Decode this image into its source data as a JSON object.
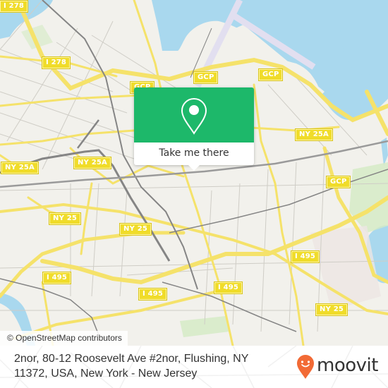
{
  "map": {
    "colors": {
      "land": "#f2f1ec",
      "water": "#a9d8ee",
      "park": "#d3ebc4",
      "airport": "#e2dff0",
      "road_major": "#f5e26a",
      "road_major_casing": "#e0c94a",
      "road_minor": "#cfcdc6",
      "rail": "#858585"
    },
    "shields": [
      {
        "label": "I 278",
        "id": "i278-top"
      },
      {
        "label": "I 278",
        "id": "i278"
      },
      {
        "label": "GCP",
        "id": "gcp-1"
      },
      {
        "label": "GCP",
        "id": "gcp-2"
      },
      {
        "label": "GCP",
        "id": "gcp-3"
      },
      {
        "label": "NY 25A",
        "id": "ny25a-1"
      },
      {
        "label": "NY 25A",
        "id": "ny25a-2"
      },
      {
        "label": "NY 25A",
        "id": "ny25a-3"
      },
      {
        "label": "GCP",
        "id": "gcp-4"
      },
      {
        "label": "NY 25",
        "id": "ny25-1"
      },
      {
        "label": "NY 25",
        "id": "ny25-2"
      },
      {
        "label": "I 495",
        "id": "i495-1"
      },
      {
        "label": "I 495",
        "id": "i495-2"
      },
      {
        "label": "I 495",
        "id": "i495-3"
      },
      {
        "label": "I 495",
        "id": "i495-4"
      },
      {
        "label": "NY 25",
        "id": "ny25-3"
      }
    ],
    "attribution": "© OpenStreetMap contributors"
  },
  "popup": {
    "icon": "map-pin-icon",
    "button_label": "Take me there",
    "accent": "#1db86a"
  },
  "footer": {
    "address": "2nor, 80-12 Roosevelt Ave #2nor, Flushing, NY 11372, USA, New York - New Jersey",
    "logo_text": "moovit",
    "logo_icon": "moovit-pin-icon",
    "logo_color": "#f26a35"
  }
}
